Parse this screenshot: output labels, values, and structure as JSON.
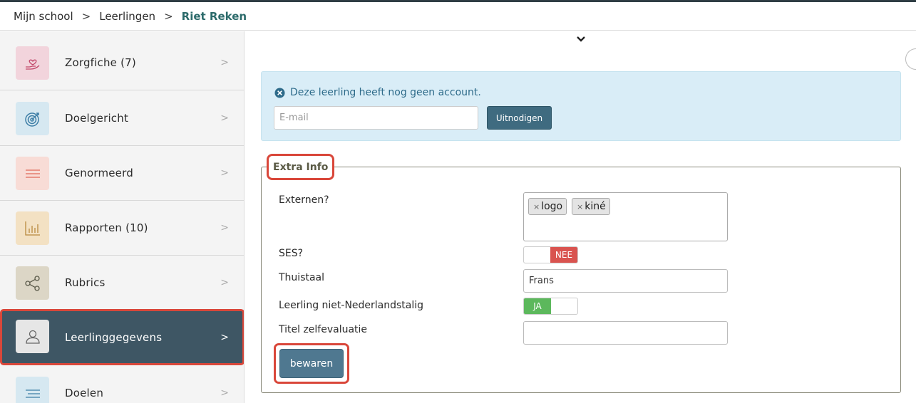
{
  "breadcrumb": {
    "items": [
      "Mijn school",
      "Leerlingen"
    ],
    "separator": ">",
    "current": "Riet Reken"
  },
  "sidebar": {
    "items": [
      {
        "label": "Zorgfiche",
        "count": "(7)",
        "icon": "hand-heart-icon",
        "color": "#f2d4dc"
      },
      {
        "label": "Doelgericht",
        "count": "",
        "icon": "target-icon",
        "color": "#d6e8f1"
      },
      {
        "label": "Genormeerd",
        "count": "",
        "icon": "lines-icon",
        "color": "#f8dcd6"
      },
      {
        "label": "Rapporten",
        "count": "(10)",
        "icon": "bar-chart-icon",
        "color": "#f3e1c3"
      },
      {
        "label": "Rubrics",
        "count": "",
        "icon": "share-icon",
        "color": "#dcd6c6"
      },
      {
        "label": "Leerlinggegevens",
        "count": "",
        "icon": "user-icon",
        "color": "#e6e6e6",
        "active": true
      },
      {
        "label": "Doelen",
        "count": "",
        "icon": "align-icon",
        "color": "#d6e8f1"
      }
    ],
    "chevron": ">"
  },
  "alert": {
    "message": "Deze leerling heeft nog geen account.",
    "email_placeholder": "E-mail",
    "invite_label": "Uitnodigen"
  },
  "extra_info": {
    "legend": "Extra Info",
    "externen_label": "Externen?",
    "externen_tags": [
      "logo",
      "kiné"
    ],
    "tag_remove": "×",
    "ses_label": "SES?",
    "ses_value": "NEE",
    "thuistaal_label": "Thuistaal",
    "thuistaal_value": "Frans",
    "niet_nl_label": "Leerling niet-Nederlandstalig",
    "niet_nl_value": "JA",
    "titel_label": "Titel zelfevaluatie",
    "titel_value": "",
    "save_label": "bewaren"
  },
  "colors": {
    "accent": "#3e5664",
    "highlight": "#d9473a",
    "alert_bg": "#d9edf7",
    "toggle_off": "#d9534f",
    "toggle_on": "#5cb85c"
  }
}
